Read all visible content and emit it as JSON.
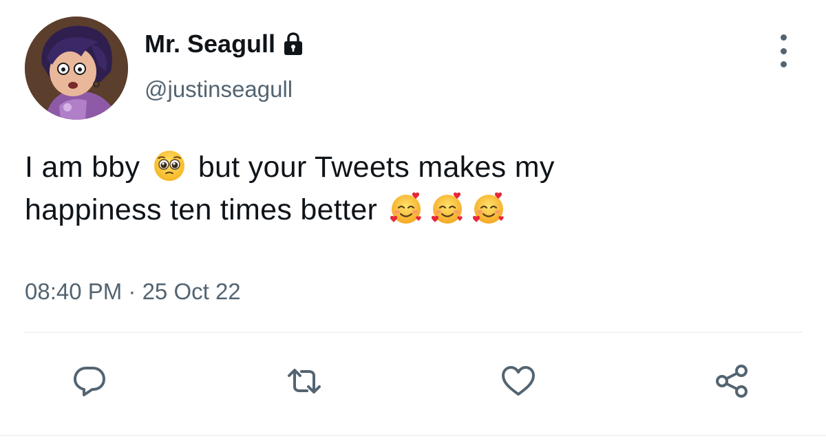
{
  "tweet": {
    "display_name": "Mr. Seagull",
    "handle": "@justinseagull",
    "protected_icon": "lock-icon",
    "avatar_icon": "cartoon-avatar",
    "text_line_1_a": "I am bby",
    "text_line_1_emoji": "pleading-face-emoji",
    "text_line_1_b": "but your Tweets makes my",
    "text_line_2": "happiness ten times better",
    "text_line_2_emojis": [
      "smiling-face-with-hearts-emoji",
      "smiling-face-with-hearts-emoji",
      "smiling-face-with-hearts-emoji"
    ],
    "timestamp": "08:40 PM · 25 Oct 22"
  },
  "actions": {
    "reply_icon": "reply-icon",
    "retweet_icon": "retweet-icon",
    "like_icon": "heart-icon",
    "share_icon": "share-icon",
    "more_icon": "more-vertical-icon"
  },
  "colors": {
    "text_primary": "#0f1419",
    "text_secondary": "#536471",
    "divider": "#eff3f4"
  }
}
